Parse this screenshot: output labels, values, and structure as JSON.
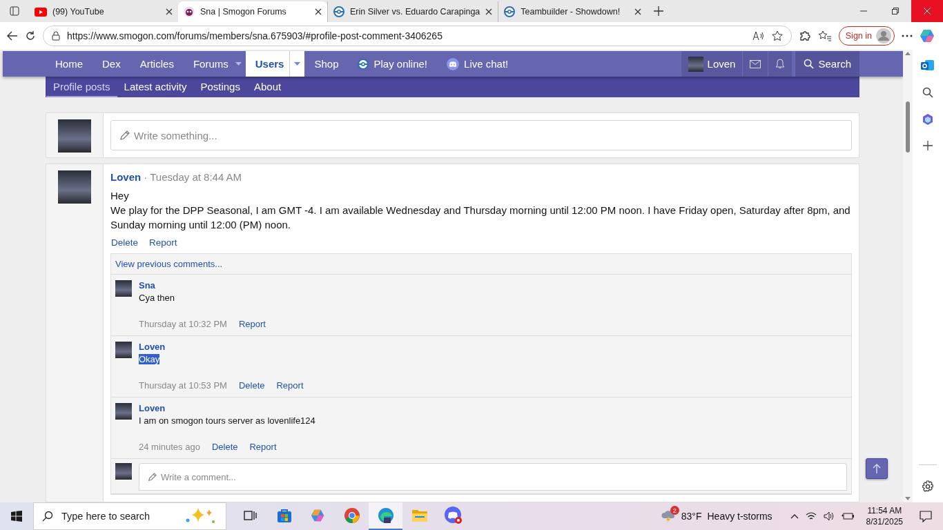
{
  "browser": {
    "tabs": [
      {
        "title": "(99) YouTube",
        "kind": "youtube",
        "selected": false
      },
      {
        "title": "Sna | Smogon Forums",
        "kind": "smogon",
        "selected": true
      },
      {
        "title": "Erin Silver vs. Eduardo Carapinga",
        "kind": "showdown",
        "selected": false
      },
      {
        "title": "Teambuilder - Showdown!",
        "kind": "showdown",
        "selected": false
      }
    ],
    "url": "https://www.smogon.com/forums/members/sna.675903/#profile-post-comment-3406265",
    "sign_in": "Sign in"
  },
  "nav": {
    "items": [
      {
        "label": "Home",
        "kind": "plain",
        "selected": false,
        "dropdown": false
      },
      {
        "label": "Dex",
        "kind": "plain",
        "selected": false,
        "dropdown": false
      },
      {
        "label": "Articles",
        "kind": "plain",
        "selected": false,
        "dropdown": false
      },
      {
        "label": "Forums",
        "kind": "plain",
        "selected": false,
        "dropdown": true
      },
      {
        "label": "Users",
        "kind": "plain",
        "selected": true,
        "dropdown": true
      },
      {
        "label": "Shop",
        "kind": "plain",
        "selected": false,
        "dropdown": false
      },
      {
        "label": "Play online!",
        "kind": "showdown",
        "selected": false,
        "dropdown": false
      },
      {
        "label": "Live chat!",
        "kind": "discord",
        "selected": false,
        "dropdown": false
      }
    ],
    "user": "Loven",
    "search": "Search"
  },
  "subnav": [
    {
      "label": "Profile posts",
      "selected": true
    },
    {
      "label": "Latest activity",
      "selected": false
    },
    {
      "label": "Postings",
      "selected": false
    },
    {
      "label": "About",
      "selected": false
    }
  ],
  "composer": {
    "placeholder": "Write something..."
  },
  "post": {
    "author": "Loven",
    "time": "· Tuesday at 8:44 AM",
    "lines": [
      "Hey",
      "We play for the DPP Seasonal, I am GMT -4. I am available Wednesday and Thursday morning until 12:00 PM noon. I have Friday open, Saturday after 8pm, and Sunday morning until 12:00 (PM) noon."
    ],
    "actions": [
      "Delete",
      "Report"
    ],
    "comments": {
      "more": "View previous comments...",
      "items": [
        {
          "author": "Sna",
          "text": "Cya then",
          "highlighted": false,
          "time": "Thursday at 10:32 PM",
          "actions": [
            "Report"
          ]
        },
        {
          "author": "Loven",
          "text": "Okay",
          "highlighted": true,
          "time": "Thursday at 10:53 PM",
          "actions": [
            "Delete",
            "Report"
          ]
        },
        {
          "author": "Loven",
          "text": "I am on smogon tours server as lovenlife124",
          "highlighted": false,
          "time": "24 minutes ago",
          "actions": [
            "Delete",
            "Report"
          ]
        }
      ],
      "placeholder": "Write a comment..."
    }
  },
  "taskbar": {
    "search": "Type here to search",
    "apps": [
      {
        "kind": "taskview",
        "selected": false
      },
      {
        "kind": "store",
        "selected": false
      },
      {
        "kind": "copilot",
        "selected": false
      },
      {
        "kind": "chrome",
        "selected": false
      },
      {
        "kind": "edge",
        "selected": true
      },
      {
        "kind": "files",
        "selected": false
      },
      {
        "kind": "discord",
        "selected": false
      }
    ],
    "weather": {
      "badge": "2",
      "temp": "83°F",
      "text": "Heavy t-storms"
    },
    "time": "11:54 AM",
    "date": "8/31/2025"
  }
}
